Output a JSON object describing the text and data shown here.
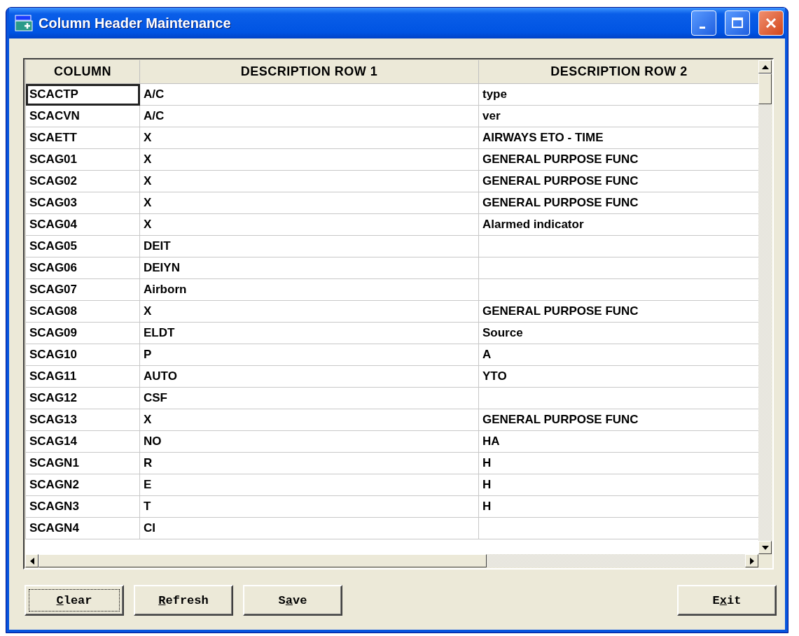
{
  "window": {
    "title": "Column Header Maintenance"
  },
  "table": {
    "columns": [
      "COLUMN",
      "DESCRIPTION ROW 1",
      "DESCRIPTION ROW 2"
    ],
    "rows": [
      {
        "column": "SCACTP",
        "row_1": "A/C",
        "row_2": "type",
        "selected": true
      },
      {
        "column": "SCACVN",
        "row_1": "A/C",
        "row_2": "ver",
        "selected": false
      },
      {
        "column": "SCAETT",
        "row_1": "X",
        "row_2": "AIRWAYS ETO - TIME",
        "selected": false
      },
      {
        "column": "SCAG01",
        "row_1": "X",
        "row_2": "GENERAL PURPOSE FUNC",
        "selected": false
      },
      {
        "column": "SCAG02",
        "row_1": "X",
        "row_2": "GENERAL PURPOSE FUNC",
        "selected": false
      },
      {
        "column": "SCAG03",
        "row_1": "X",
        "row_2": "GENERAL PURPOSE FUNC",
        "selected": false
      },
      {
        "column": "SCAG04",
        "row_1": "X",
        "row_2": "Alarmed indicator",
        "selected": false
      },
      {
        "column": "SCAG05",
        "row_1": "DEIT",
        "selected": false
      },
      {
        "column": "SCAG06",
        "row_1": "DEIYN",
        "selected": false
      },
      {
        "column": "SCAG07",
        "row_1": "Airborn",
        "selected": false
      },
      {
        "column": "SCAG08",
        "row_1": "X",
        "row_2": "GENERAL PURPOSE FUNC",
        "selected": false
      },
      {
        "column": "SCAG09",
        "row_1": "ELDT",
        "row_2": "Source",
        "selected": false
      },
      {
        "column": "SCAG10",
        "row_1": "P",
        "row_2": "A",
        "selected": false
      },
      {
        "column": "SCAG11",
        "row_1": "AUTO",
        "row_2": "YTO",
        "selected": false
      },
      {
        "column": "SCAG12",
        "row_1": "CSF",
        "selected": false
      },
      {
        "column": "SCAG13",
        "row_1": "X",
        "row_2": "GENERAL PURPOSE FUNC",
        "selected": false
      },
      {
        "column": "SCAG14",
        "row_1": "NO",
        "row_2": "HA",
        "selected": false
      },
      {
        "column": "SCAGN1",
        "row_1": "R",
        "row_2": "H",
        "selected": false
      },
      {
        "column": "SCAGN2",
        "row_1": "E",
        "row_2": "H",
        "selected": false
      },
      {
        "column": "SCAGN3",
        "row_1": "T",
        "row_2": "H",
        "selected": false
      },
      {
        "column": "SCAGN4",
        "row_1": "CI",
        "selected": false
      }
    ]
  },
  "left_buttons": [
    {
      "mnemonic": "C",
      "after": "lear",
      "focused": true
    },
    {
      "mnemonic": "R",
      "after": "efresh",
      "focused": false
    },
    {
      "before": "S",
      "mnemonic": "a",
      "after": "ve",
      "focused": false
    }
  ],
  "right_buttons": [
    {
      "before": "E",
      "mnemonic": "x",
      "after": "it",
      "focused": false
    }
  ]
}
